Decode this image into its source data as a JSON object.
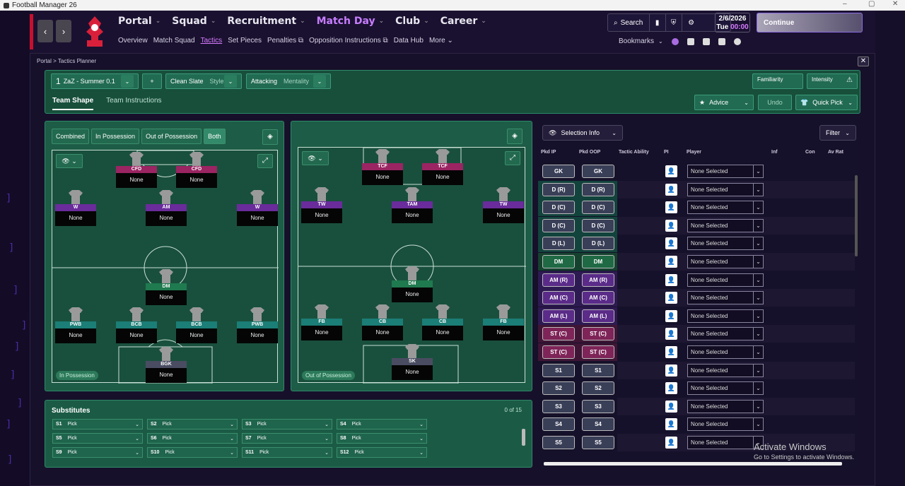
{
  "window": {
    "title": "Football Manager 26",
    "controls": [
      "–",
      "▢",
      "✕"
    ]
  },
  "nav": {
    "back": "‹",
    "forward": "›",
    "menu": [
      {
        "label": "Portal",
        "active": false
      },
      {
        "label": "Squad",
        "active": false
      },
      {
        "label": "Recruitment",
        "active": false
      },
      {
        "label": "Match Day",
        "active": true
      },
      {
        "label": "Club",
        "active": false
      },
      {
        "label": "Career",
        "active": false
      }
    ],
    "submenu": [
      {
        "label": "Overview"
      },
      {
        "label": "Match Squad"
      },
      {
        "label": "Tactics",
        "active": true
      },
      {
        "label": "Set Pieces"
      },
      {
        "label": "Penalties ⧉"
      },
      {
        "label": "Opposition Instructions ⧉"
      },
      {
        "label": "Data Hub"
      },
      {
        "label": "More ⌄"
      }
    ],
    "search": "Search",
    "date": {
      "day_month": "2/6/2026",
      "weekday": "Tue",
      "time": "00:00"
    },
    "continue": "Continue",
    "bookmarks": "Bookmarks"
  },
  "breadcrumb": {
    "items": [
      "Portal",
      "Tactics Planner"
    ],
    "sep": ">"
  },
  "tactic_header": {
    "slot_number": "1",
    "tactic_name": "ZaZ - Summer 0.1",
    "add": "+",
    "style_value": "Clean Slate",
    "style_label": "Style",
    "mentality_value": "Attacking",
    "mentality_label": "Mentality",
    "familiarity": "Familiarity",
    "intensity": "Intensity",
    "tabs": [
      {
        "label": "Team Shape",
        "active": true
      },
      {
        "label": "Team Instructions",
        "active": false
      }
    ],
    "advice": "Advice",
    "undo": "Undo",
    "quick_pick": "Quick Pick"
  },
  "phase_tabs": [
    {
      "label": "Combined"
    },
    {
      "label": "In Possession"
    },
    {
      "label": "Out of Possession"
    },
    {
      "label": "Both",
      "active": true
    }
  ],
  "in_possession": {
    "tag": "In Possession",
    "players": [
      {
        "role": "CFD",
        "name": "None",
        "color": "#9b2463"
      },
      {
        "role": "CFD",
        "name": "None",
        "color": "#9b2463"
      },
      {
        "role": "W",
        "name": "None",
        "color": "#6a2b9b"
      },
      {
        "role": "AM",
        "name": "None",
        "color": "#6a2b9b"
      },
      {
        "role": "W",
        "name": "None",
        "color": "#6a2b9b"
      },
      {
        "role": "DM",
        "name": "None",
        "color": "#1f7a4f"
      },
      {
        "role": "PWB",
        "name": "None",
        "color": "#1b7e77"
      },
      {
        "role": "BCB",
        "name": "None",
        "color": "#1b7e77"
      },
      {
        "role": "BCB",
        "name": "None",
        "color": "#1b7e77"
      },
      {
        "role": "PWB",
        "name": "None",
        "color": "#1b7e77"
      },
      {
        "role": "BGK",
        "name": "None",
        "color": "#4a4c62"
      }
    ]
  },
  "out_possession": {
    "tag": "Out of Possession",
    "players": [
      {
        "role": "TCF",
        "name": "None",
        "color": "#9b2463"
      },
      {
        "role": "TCF",
        "name": "None",
        "color": "#9b2463"
      },
      {
        "role": "TW",
        "name": "None",
        "color": "#6a2b9b"
      },
      {
        "role": "TAM",
        "name": "None",
        "color": "#6a2b9b"
      },
      {
        "role": "TW",
        "name": "None",
        "color": "#6a2b9b"
      },
      {
        "role": "DM",
        "name": "None",
        "color": "#1f7a4f"
      },
      {
        "role": "FB",
        "name": "None",
        "color": "#1b7e77"
      },
      {
        "role": "CB",
        "name": "None",
        "color": "#1b7e77"
      },
      {
        "role": "CB",
        "name": "None",
        "color": "#1b7e77"
      },
      {
        "role": "FB",
        "name": "None",
        "color": "#1b7e77"
      },
      {
        "role": "SK",
        "name": "None",
        "color": "#4a4c62"
      }
    ]
  },
  "substitutes": {
    "title": "Substitutes",
    "count": "0 of 15",
    "slots": [
      {
        "id": "S1",
        "label": "Pick"
      },
      {
        "id": "S2",
        "label": "Pick"
      },
      {
        "id": "S3",
        "label": "Pick"
      },
      {
        "id": "S4",
        "label": "Pick"
      },
      {
        "id": "S5",
        "label": "Pick"
      },
      {
        "id": "S6",
        "label": "Pick"
      },
      {
        "id": "S7",
        "label": "Pick"
      },
      {
        "id": "S8",
        "label": "Pick"
      },
      {
        "id": "S9",
        "label": "Pick"
      },
      {
        "id": "S10",
        "label": "Pick"
      },
      {
        "id": "S11",
        "label": "Pick"
      },
      {
        "id": "S12",
        "label": "Pick"
      }
    ]
  },
  "selection": {
    "info": "Selection Info",
    "filter": "Filter",
    "columns": [
      "Pkd IP",
      "Pkd OOP",
      "Tactic Ability",
      "PI",
      "Player",
      "Inf",
      "Con",
      "Av Rat"
    ],
    "rows": [
      {
        "ip": "GK",
        "oop": "GK",
        "player": "None Selected",
        "color": "#3a3f58",
        "band": "#16112a"
      },
      {
        "ip": "D (R)",
        "oop": "D (R)",
        "player": "None Selected",
        "color": "#3a3f58",
        "band": "#12433c"
      },
      {
        "ip": "D (C)",
        "oop": "D (C)",
        "player": "None Selected",
        "color": "#3a3f58",
        "band": "#12433c"
      },
      {
        "ip": "D (C)",
        "oop": "D (C)",
        "player": "None Selected",
        "color": "#3a3f58",
        "band": "#12433c"
      },
      {
        "ip": "D (L)",
        "oop": "D (L)",
        "player": "None Selected",
        "color": "#3a3f58",
        "band": "#12433c"
      },
      {
        "ip": "DM",
        "oop": "DM",
        "player": "None Selected",
        "color": "#1f6a45",
        "band": "#15422e"
      },
      {
        "ip": "AM (R)",
        "oop": "AM (R)",
        "player": "None Selected",
        "color": "#5a2b88",
        "band": "#2e1a52"
      },
      {
        "ip": "AM (C)",
        "oop": "AM (C)",
        "player": "None Selected",
        "color": "#5a2b88",
        "band": "#2e1a52"
      },
      {
        "ip": "AM (L)",
        "oop": "AM (L)",
        "player": "None Selected",
        "color": "#5a2b88",
        "band": "#2e1a52"
      },
      {
        "ip": "ST (C)",
        "oop": "ST (C)",
        "player": "None Selected",
        "color": "#7e2458",
        "band": "#3f1535"
      },
      {
        "ip": "ST (C)",
        "oop": "ST (C)",
        "player": "None Selected",
        "color": "#7e2458",
        "band": "#3f1535"
      },
      {
        "ip": "S1",
        "oop": "S1",
        "player": "None Selected",
        "color": "#3a3f58",
        "band": "#16112a"
      },
      {
        "ip": "S2",
        "oop": "S2",
        "player": "None Selected",
        "color": "#3a3f58",
        "band": "#16112a"
      },
      {
        "ip": "S3",
        "oop": "S3",
        "player": "None Selected",
        "color": "#3a3f58",
        "band": "#16112a"
      },
      {
        "ip": "S4",
        "oop": "S4",
        "player": "None Selected",
        "color": "#3a3f58",
        "band": "#16112a"
      },
      {
        "ip": "S5",
        "oop": "S5",
        "player": "None Selected",
        "color": "#3a3f58",
        "band": "#16112a"
      }
    ]
  },
  "watermark": {
    "title": "Activate Windows",
    "subtitle": "Go to Settings to activate Windows."
  }
}
